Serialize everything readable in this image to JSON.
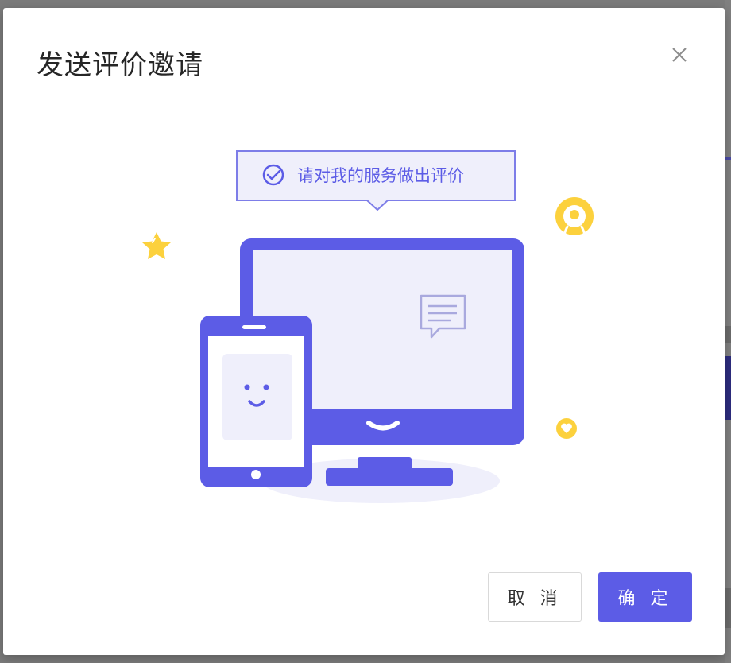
{
  "dialog": {
    "title": "发送评价邀请",
    "bubble_text": "请对我的服务做出评价",
    "cancel_label": "取 消",
    "confirm_label": "确 定"
  },
  "icons": {
    "close": "close-icon",
    "check": "check-circle-icon",
    "star": "star-icon",
    "medal": "medal-icon",
    "heart": "heart-icon",
    "chat": "chat-icon"
  },
  "colors": {
    "primary": "#5c5ce6",
    "primary_light": "#efeffb",
    "yellow": "#fcd13d",
    "title_text": "#262626"
  }
}
